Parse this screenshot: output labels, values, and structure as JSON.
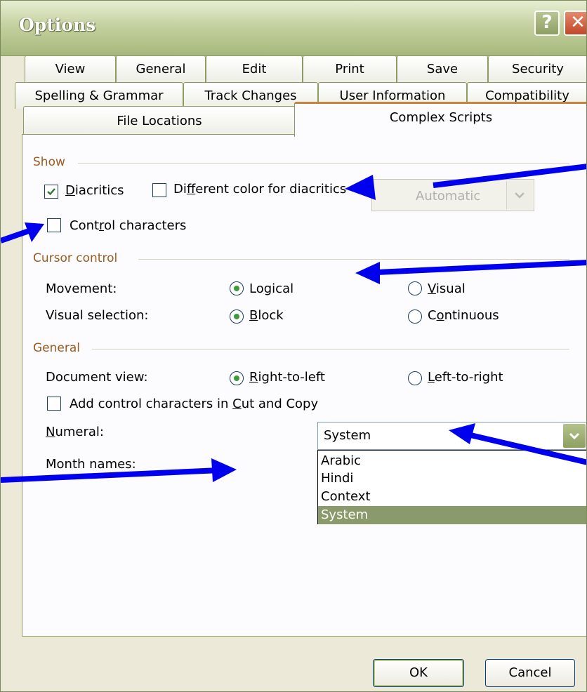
{
  "window": {
    "title": "Options",
    "help_label": "?",
    "close_label": "✕"
  },
  "tabs": {
    "row1": [
      "View",
      "General",
      "Edit",
      "Print",
      "Save",
      "Security"
    ],
    "row2": [
      "Spelling & Grammar",
      "Track Changes",
      "User Information",
      "Compatibility"
    ],
    "row3": [
      "File Locations",
      "Complex Scripts"
    ],
    "active": "Complex Scripts"
  },
  "show": {
    "title": "Show",
    "diacritics": {
      "pre": "",
      "key": "D",
      "post": "iacritics",
      "checked": true
    },
    "diff_color": {
      "pre": "Di",
      "key": "f",
      "post": "ferent color for diacritics",
      "checked": false
    },
    "color_combo": {
      "value": "Automatic",
      "enabled": false
    },
    "control_chars": {
      "pre": "Cont",
      "key": "r",
      "post": "ol characters",
      "checked": false
    }
  },
  "cursor": {
    "title": "Cursor control",
    "movement_label": "Movement:",
    "movement_logical": {
      "pre": "Lo",
      "key": "g",
      "post": "ical",
      "selected": true
    },
    "movement_visual": {
      "pre": "",
      "key": "V",
      "post": "isual",
      "selected": false
    },
    "selection_label": "Visual selection:",
    "selection_block": {
      "pre": "",
      "key": "B",
      "post": "lock",
      "selected": true
    },
    "selection_continuous": {
      "pre": "C",
      "key": "o",
      "post": "ntinuous",
      "selected": false
    }
  },
  "general": {
    "title": "General",
    "docview_label": "Document view:",
    "docview_rtl": {
      "pre": "",
      "key": "R",
      "post": "ight-to-left",
      "selected": true
    },
    "docview_ltr": {
      "pre": "",
      "key": "L",
      "post": "eft-to-right",
      "selected": false
    },
    "add_control": {
      "pre": "Add control characters in ",
      "key": "C",
      "post": "ut and Copy",
      "checked": false
    },
    "numeral_label": {
      "pre": "",
      "key": "N",
      "post": "umeral:"
    },
    "numeral_value": "System",
    "numeral_options": [
      "Arabic",
      "Hindi",
      "Context",
      "System"
    ],
    "numeral_selected": "System",
    "month_label": "Month names:"
  },
  "buttons": {
    "ok": "OK",
    "cancel": "Cancel"
  },
  "colors": {
    "accent": "#c8843c",
    "annotation_arrow": "#0000ee",
    "selected_option": "#8b9a6b"
  }
}
